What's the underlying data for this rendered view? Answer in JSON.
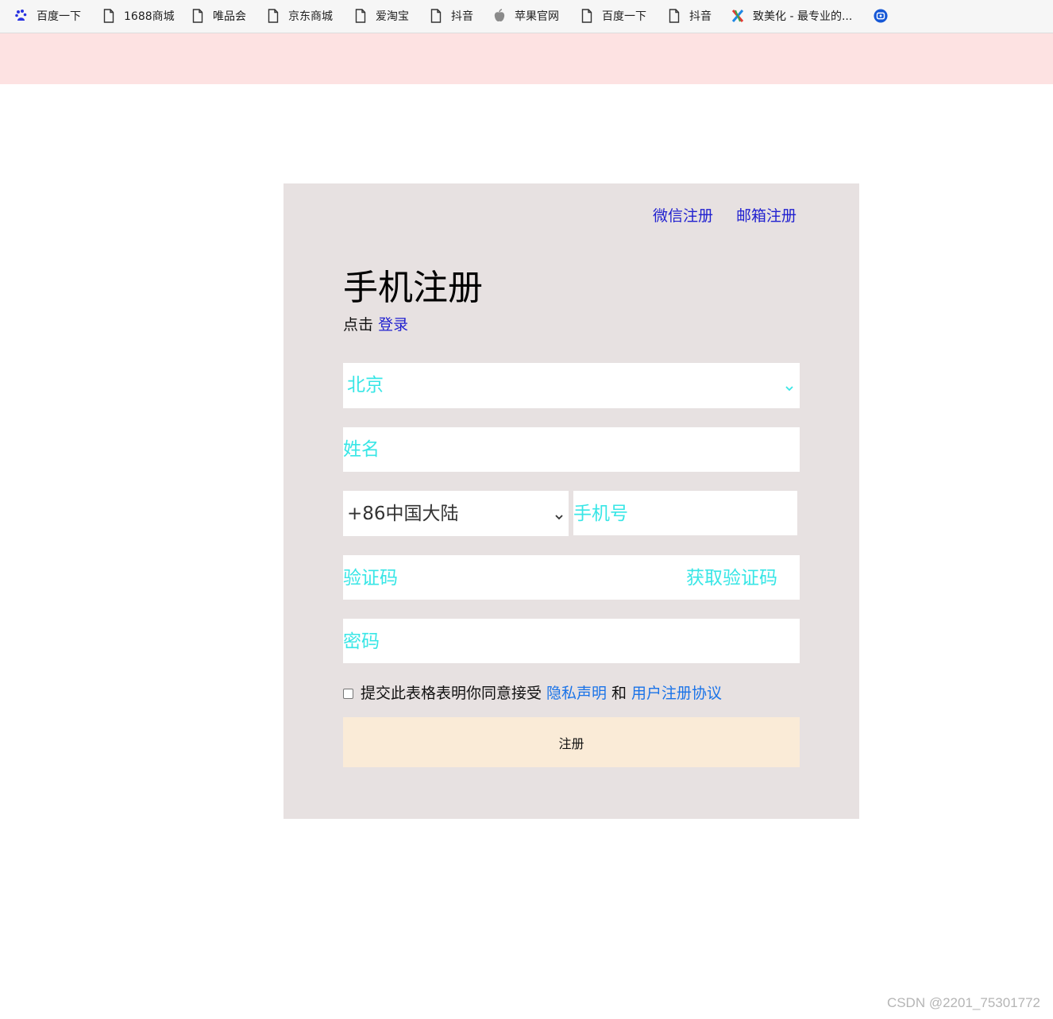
{
  "bookmarks": [
    {
      "label": "百度一下",
      "icon": "baidu-paw-icon"
    },
    {
      "label": "1688商城",
      "icon": "page-icon"
    },
    {
      "label": "唯品会",
      "icon": "page-icon"
    },
    {
      "label": "京东商城",
      "icon": "page-icon"
    },
    {
      "label": "爱淘宝",
      "icon": "page-icon"
    },
    {
      "label": "抖音",
      "icon": "page-icon"
    },
    {
      "label": "苹果官网",
      "icon": "apple-icon"
    },
    {
      "label": "百度一下",
      "icon": "page-icon"
    },
    {
      "label": "抖音",
      "icon": "page-icon"
    },
    {
      "label": "致美化 - 最专业的...",
      "icon": "zhimeihua-icon"
    },
    {
      "label": "",
      "icon": "app-circle-icon"
    }
  ],
  "register": {
    "wechat_link": "微信注册",
    "email_link": "邮箱注册",
    "title": "手机注册",
    "login_prefix": "点击",
    "login_link": "登录",
    "city_select": "北京",
    "name_placeholder": "姓名",
    "country_code": "+86中国大陆",
    "phone_placeholder": "手机号",
    "code_placeholder": "验证码",
    "get_code": "获取验证码",
    "password_placeholder": "密码",
    "agree_text": "提交此表格表明你同意接受",
    "privacy_link": "隐私声明",
    "and_text": "和",
    "terms_link": "用户注册协议",
    "submit_label": "注册"
  },
  "watermark": "CSDN @2201_75301772",
  "colors": {
    "panel_bg": "#e7e1e1",
    "banner_bg": "#fde2e2",
    "placeholder": "#38e6e6",
    "link_blue": "#1f1fd0",
    "agreement_link": "#1a73e8",
    "submit_bg": "#faebd7"
  }
}
